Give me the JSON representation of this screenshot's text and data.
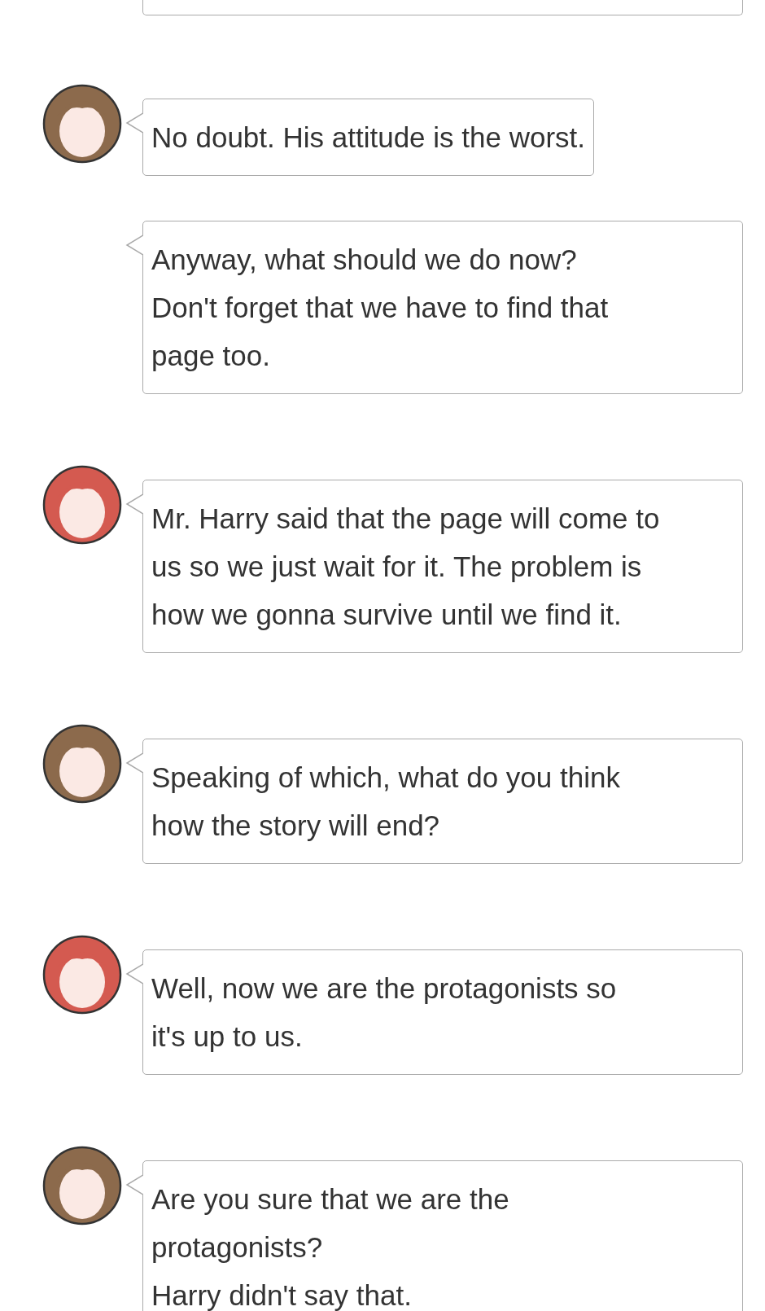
{
  "messages": [
    {
      "kind": "avatar",
      "color": "#8c6a4c",
      "text": "No doubt. His attitude is the worst."
    },
    {
      "kind": "continued",
      "text": "Anyway, what should we do now?\nDon't forget that we have to find that\npage too."
    },
    {
      "kind": "avatar",
      "color": "#d45a50",
      "text": "Mr. Harry said that the page will come to\nus so we just wait for it. The problem is\nhow we gonna survive until we find it."
    },
    {
      "kind": "avatar",
      "color": "#8c6a4c",
      "text": "Speaking of which, what do you think\nhow the story will end?"
    },
    {
      "kind": "avatar",
      "color": "#d45a50",
      "text": "Well, now we are the protagonists so\nit's up to us."
    },
    {
      "kind": "avatar",
      "color": "#8c6a4c",
      "text": "Are you sure that we are the\nprotagonists?\nHarry didn't say that."
    }
  ]
}
